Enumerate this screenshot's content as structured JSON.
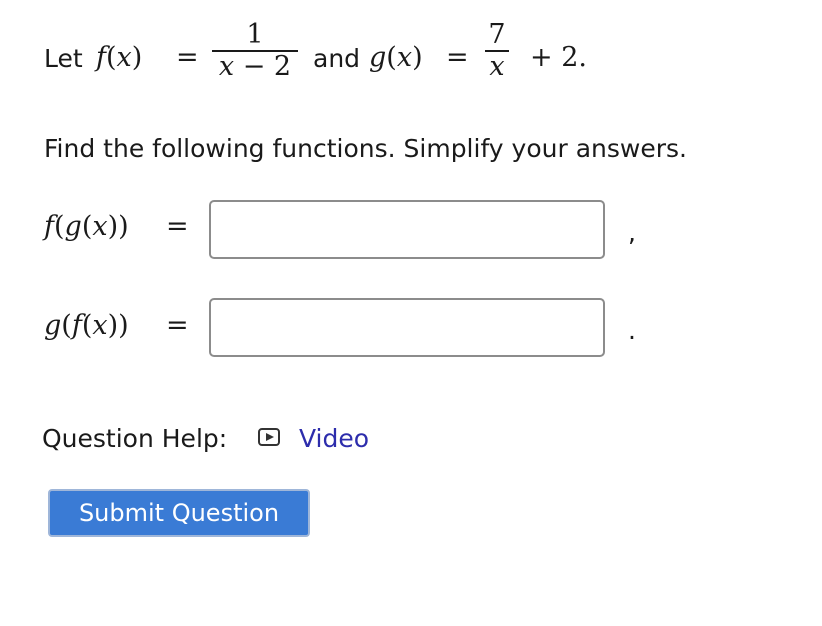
{
  "problem": {
    "let_word": "Let",
    "f_name": "f",
    "x_var": "x",
    "f_numerator": "1",
    "f_den_var": "x",
    "f_den_op": "−",
    "f_den_const": "2",
    "and_word": "and",
    "g_name": "g",
    "g_numerator": "7",
    "g_den_var": "x",
    "g_plus_term": "+ 2.",
    "equals": "=",
    "instructions": "Find the following functions. Simplify your answers."
  },
  "answers": [
    {
      "label_outer": "f",
      "label_inner": "g",
      "var": "x",
      "value": "",
      "trailing": ","
    },
    {
      "label_outer": "g",
      "label_inner": "f",
      "var": "x",
      "value": "",
      "trailing": "."
    }
  ],
  "help": {
    "label": "Question Help:",
    "video_icon": "play-icon",
    "video_label": "Video"
  },
  "submit": {
    "label": "Submit Question",
    "color": "#3a7bd5"
  },
  "colors": {
    "link": "#2d2dac",
    "text": "#1a1a1a"
  }
}
